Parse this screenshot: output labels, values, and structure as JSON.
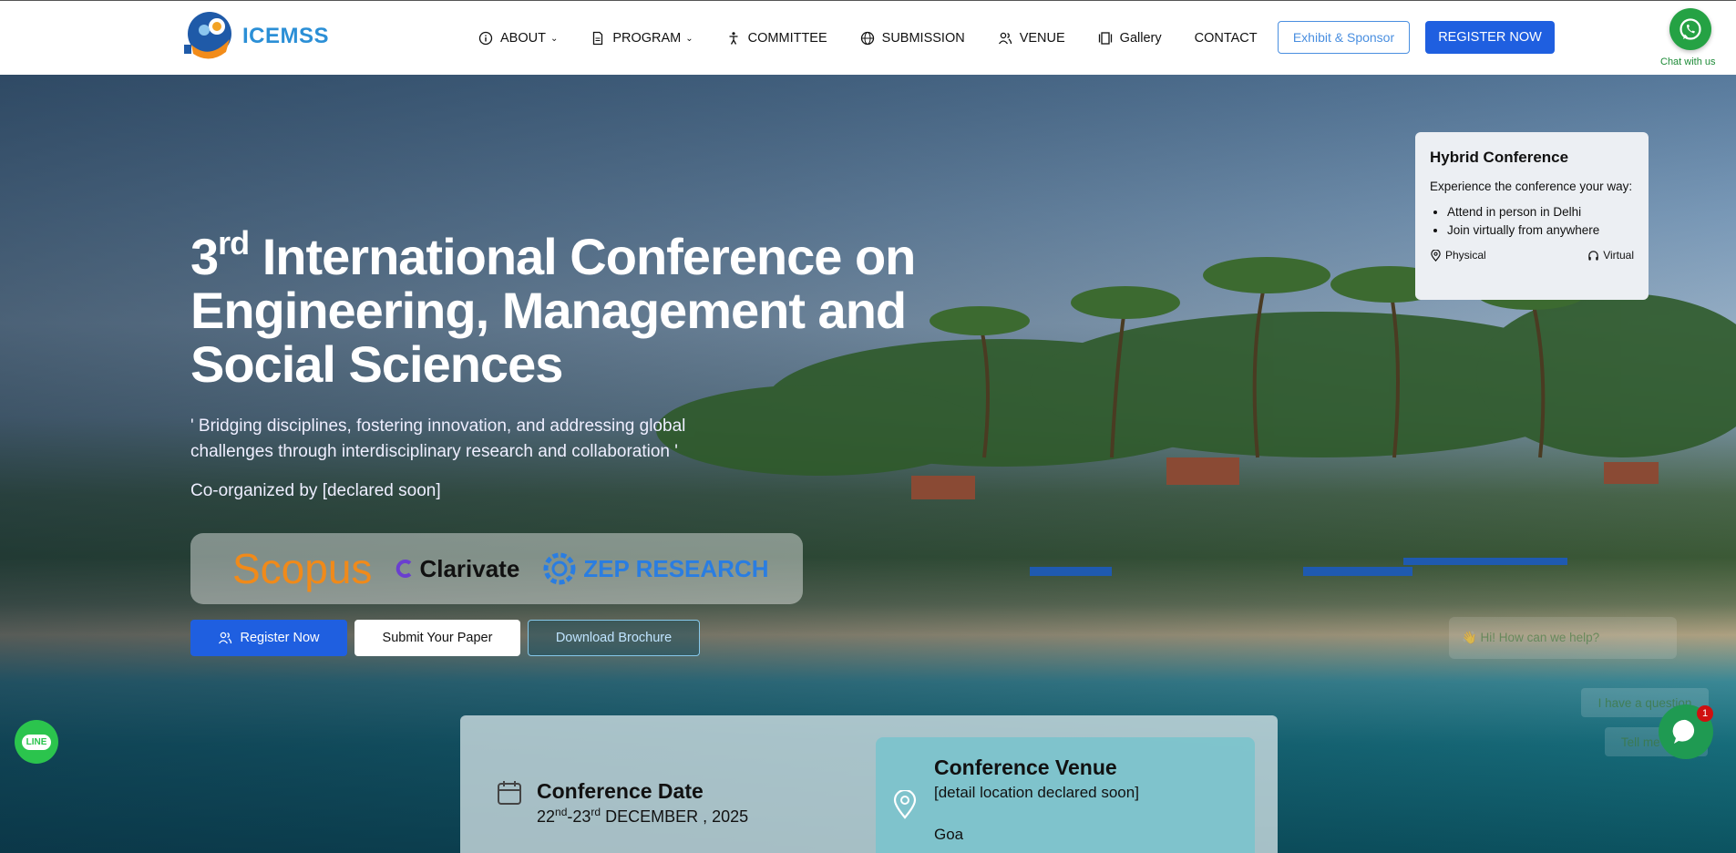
{
  "brand": {
    "name": "ICEMSS"
  },
  "nav": {
    "items": [
      {
        "label": "ABOUT",
        "icon": "info-icon",
        "dropdown": true
      },
      {
        "label": "PROGRAM",
        "icon": "document-icon",
        "dropdown": true
      },
      {
        "label": "COMMITTEE",
        "icon": "person-icon",
        "dropdown": false
      },
      {
        "label": "SUBMISSION",
        "icon": "globe-icon",
        "dropdown": false
      },
      {
        "label": "VENUE",
        "icon": "users-icon",
        "dropdown": false
      },
      {
        "label": "Gallery",
        "icon": "gallery-icon",
        "dropdown": false
      },
      {
        "label": "CONTACT",
        "icon": "",
        "dropdown": false
      }
    ],
    "exhibit_label": "Exhibit & Sponsor",
    "register_label": "REGISTER NOW"
  },
  "whatsapp": {
    "label": "Chat with us"
  },
  "hero": {
    "title_ordinal": "3",
    "title_suffix": "rd",
    "title_rest": " International Conference on Engineering, Management and Social Sciences",
    "tagline": "' Bridging disciplines, fostering innovation, and addressing global challenges through interdisciplinary research and collaboration '",
    "coorganized": "Co-organized by [declared soon]",
    "partners": {
      "scopus": "Scopus",
      "clarivate": "Clarivate",
      "zep": "ZEP RESEARCH"
    },
    "buttons": {
      "register": "Register Now",
      "submit": "Submit Your Paper",
      "brochure": "Download Brochure"
    }
  },
  "hybrid": {
    "title": "Hybrid Conference",
    "description": "Experience the conference your way:",
    "bullets": [
      "Attend in person in Delhi",
      "Join virtually from anywhere"
    ],
    "physical": "Physical",
    "virtual": "Virtual"
  },
  "chatbot": {
    "greeting": "👋 Hi! How can we help?",
    "option1": "I have a question",
    "option2": "Tell me more",
    "badge": "1"
  },
  "line": {
    "label": "LINE"
  },
  "conference": {
    "date_title": "Conference Date",
    "date_d1": "22",
    "date_s1": "nd",
    "date_d2": "-23",
    "date_s2": "rd",
    "date_rest": " DECEMBER , 2025",
    "venue_title": "Conference Venue",
    "venue_line1": "[detail location declared soon]",
    "venue_line2": "Goa"
  },
  "colors": {
    "primary": "#1f5fe0",
    "whatsapp": "#25a244",
    "line": "#2bc44d"
  }
}
